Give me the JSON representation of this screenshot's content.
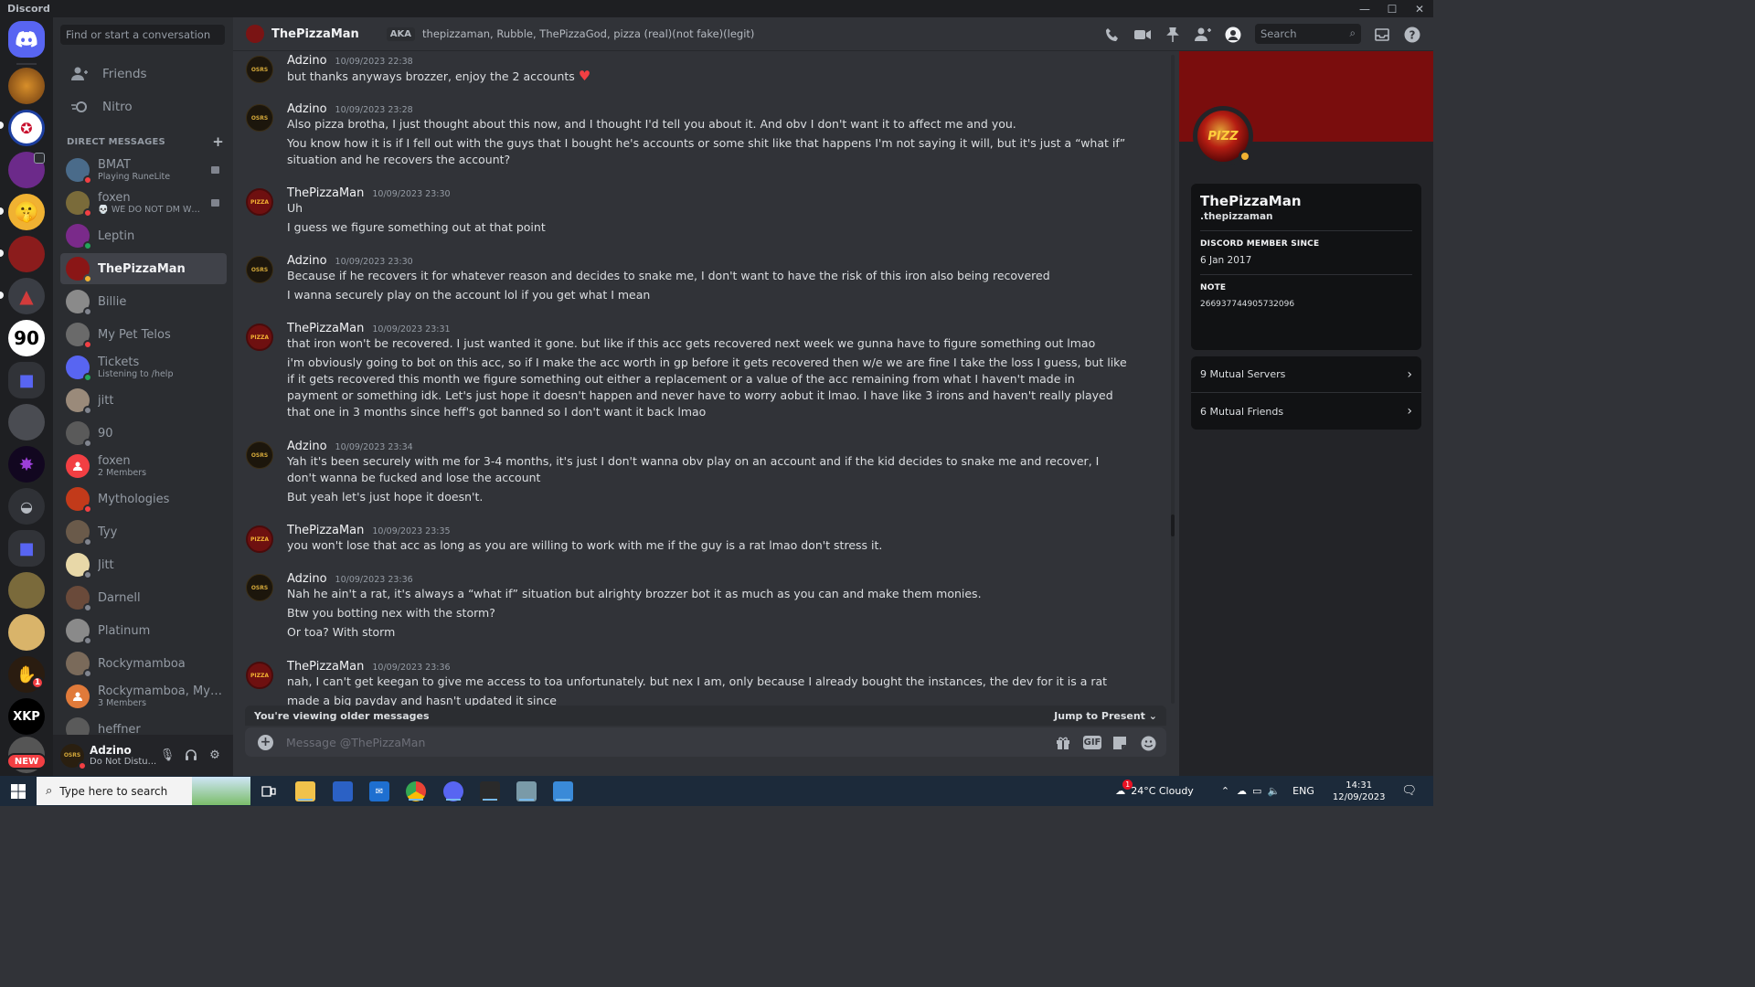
{
  "window": {
    "title": "Discord"
  },
  "dm_sidebar": {
    "search_placeholder": "Find or start a conversation",
    "nav": [
      {
        "label": "Friends"
      },
      {
        "label": "Nitro"
      }
    ],
    "section_header": "DIRECT MESSAGES",
    "dms": [
      {
        "name": "BMAT",
        "sub": "Playing RuneLite"
      },
      {
        "name": "foxen",
        "sub": "💀 WE DO NOT DM WE D..."
      },
      {
        "name": "Leptin"
      },
      {
        "name": "ThePizzaMan"
      },
      {
        "name": "Billie"
      },
      {
        "name": "My Pet Telos"
      },
      {
        "name": "Tickets",
        "sub": "Listening to /help"
      },
      {
        "name": "jitt"
      },
      {
        "name": "90"
      },
      {
        "name": "foxen",
        "sub": "2 Members"
      },
      {
        "name": "Mythologies"
      },
      {
        "name": "Tyy"
      },
      {
        "name": "Jitt"
      },
      {
        "name": "Darnell"
      },
      {
        "name": "Platinum"
      },
      {
        "name": "Rockymamboa"
      },
      {
        "name": "Rockymamboa, Myth...",
        "sub": "3 Members"
      },
      {
        "name": "heffner"
      }
    ]
  },
  "server_rail": {
    "new_badge": "NEW",
    "mention_count": "1",
    "server_90_label": "90",
    "server_xkp_label": "XKP"
  },
  "user_panel": {
    "username": "Adzino",
    "status": "Do Not Distu..."
  },
  "chat": {
    "recipient": "ThePizzaMan",
    "aka_label": "AKA",
    "aka_names": "thepizzaman, Rubble, ThePizzaGod, pizza (real)(not fake)(legit)",
    "search_placeholder": "Search",
    "groups": [
      {
        "author": "Adzino",
        "time": "10/09/2023 22:38",
        "lines": [
          "but thanks anyways brozzer, enjoy the 2 accounts"
        ]
      },
      {
        "author": "Adzino",
        "time": "10/09/2023 23:28",
        "lines": [
          "Also pizza brotha, I just thought about this now, and I thought I'd tell you about it. And obv I don't want it to affect me and you.",
          "You know how it is if I fell out with the guys that I bought he's accounts or some shit like that happens I'm not saying it will, but it's just a “what if” situation and he recovers the account?"
        ]
      },
      {
        "author": "ThePizzaMan",
        "time": "10/09/2023 23:30",
        "lines": [
          "Uh",
          "I guess we figure something out at that point"
        ]
      },
      {
        "author": "Adzino",
        "time": "10/09/2023 23:30",
        "lines": [
          "Because if he recovers it for whatever reason and decides to snake me, I don't want to have the risk of this iron also being recovered",
          "I wanna securely play on the account lol if you get what I mean"
        ]
      },
      {
        "author": "ThePizzaMan",
        "time": "10/09/2023 23:31",
        "lines": [
          "that iron won't be recovered. I just wanted it gone. but like if this acc gets recovered next week we gunna have to figure something out lmao",
          "i'm obviously going to bot on this acc, so if I make the acc worth in gp before it gets recovered then w/e we are fine I take the loss I guess, but like if it gets recovered this month we figure something out either a replacement or a value of the acc remaining from what I haven't made in payment or something idk. Let's just hope it doesn't happen and never have to worry aobut it lmao. I have like 3 irons and haven't really played that one in 3 months since heff's got banned so I don't want it back lmao"
        ]
      },
      {
        "author": "Adzino",
        "time": "10/09/2023 23:34",
        "lines": [
          "Yah it's been securely with me for 3-4 months, it's just I don't wanna obv play on an account and if the kid decides to snake me and recover, I don't wanna be fucked and lose the account",
          "But yeah let's just hope it doesn't."
        ]
      },
      {
        "author": "ThePizzaMan",
        "time": "10/09/2023 23:35",
        "lines": [
          "you won't lose that acc as long as you are willing to work with me if the guy is a rat lmao don't stress it."
        ]
      },
      {
        "author": "Adzino",
        "time": "10/09/2023 23:36",
        "lines": [
          "Nah he ain't a rat, it's always a “what if” situation but alrighty brozzer bot it as much as you can and make them monies.",
          "Btw you botting nex with the storm?",
          "Or toa? With storm"
        ]
      },
      {
        "author": "ThePizzaMan",
        "time": "10/09/2023 23:36",
        "lines": [
          "nah, I can't get keegan to give me access to toa unfortunately. but nex I am, only because I already bought the instances, the dev for it is a rat",
          "made a big payday and hasn't updated it since"
        ]
      }
    ],
    "older_notice": "You're viewing older messages",
    "jump_label": "Jump to Present",
    "composer_placeholder": "Message @ThePizzaMan",
    "gif_label": "GIF"
  },
  "profile": {
    "display_name": "ThePizzaMan",
    "username": ".thepizzaman",
    "avatar_text": "PIZZ",
    "member_since_label": "DISCORD MEMBER SINCE",
    "member_since": "6 Jan 2017",
    "note_label": "NOTE",
    "note": "266937744905732096",
    "mutual_servers": "9 Mutual Servers",
    "mutual_friends": "6 Mutual Friends"
  },
  "taskbar": {
    "search_placeholder": "Type here to search",
    "weather": "24°C  Cloudy",
    "language": "ENG",
    "time": "14:31",
    "date": "12/09/2023",
    "weather_alert": "1"
  },
  "colors": {
    "accent": "#5865f2",
    "dnd": "#f23f43",
    "online": "#23a55a",
    "idle": "#f0b232",
    "offline": "#80848e"
  }
}
